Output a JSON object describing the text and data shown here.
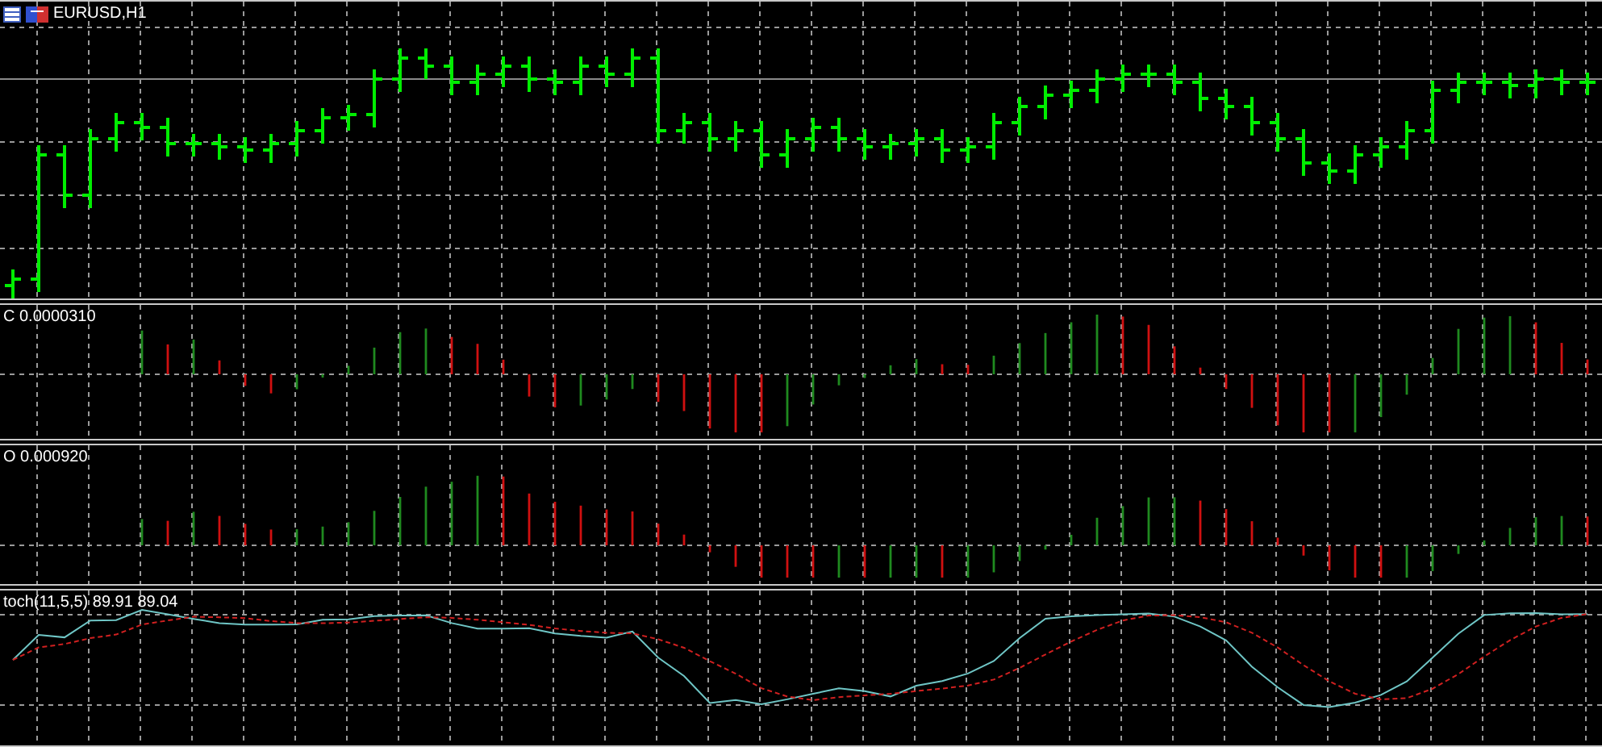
{
  "chart": {
    "symbol_label": "EURUSD,H1"
  },
  "panes": [
    {
      "kind": "histogram",
      "label": "C 0.0000310"
    },
    {
      "kind": "histogram_zero_low",
      "label": "O 0.000920"
    },
    {
      "kind": "lines",
      "label": "toch(11,5,5) 89.91 89.04"
    }
  ]
}
